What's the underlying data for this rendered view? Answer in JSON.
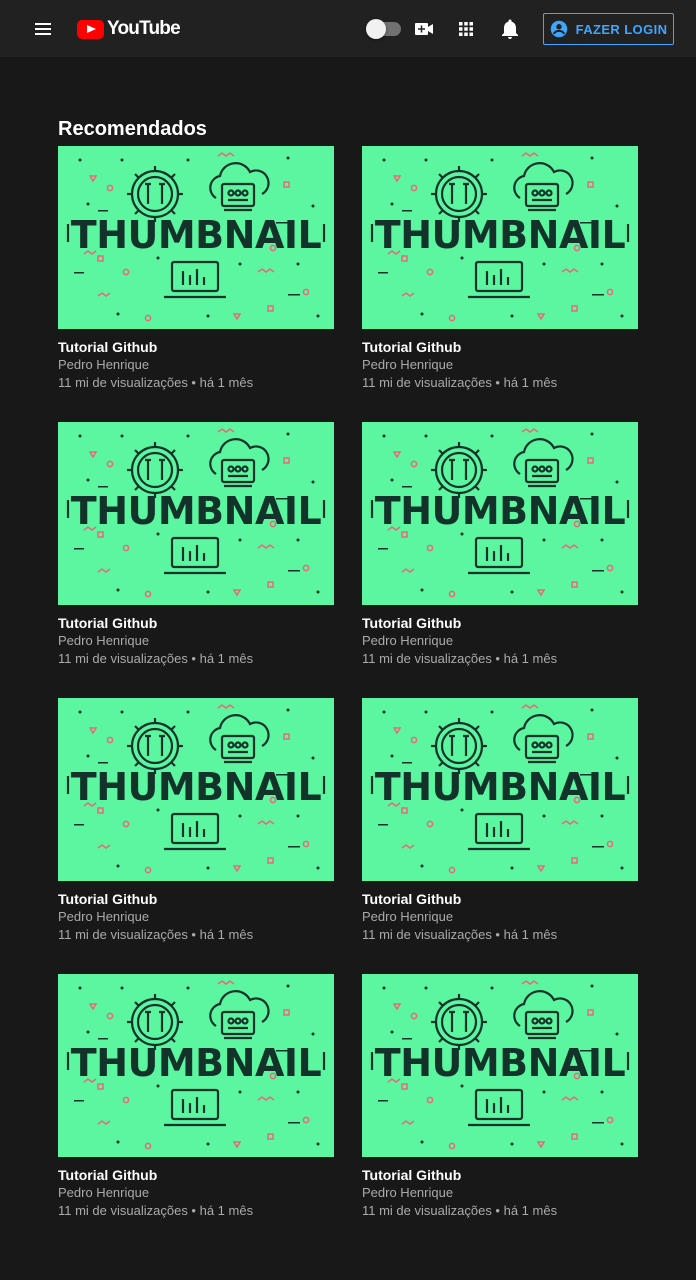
{
  "header": {
    "logo_text": "YouTube",
    "login_label": "FAZER LOGIN",
    "icons": [
      "menu-icon",
      "youtube-logo",
      "theme-toggle",
      "add-video-icon",
      "apps-grid-icon",
      "bell-icon",
      "account-circle-icon"
    ],
    "accent_color": "#3ea6ff",
    "brand_color": "#ff0000"
  },
  "section": {
    "title": "Recomendados"
  },
  "videos": [
    {
      "thumb_text": "THUMBNAIL",
      "title": "Tutorial Github",
      "channel": "Pedro Henrique",
      "meta": "11 mi de visualizações • há 1 mês"
    },
    {
      "thumb_text": "THUMBNAIL",
      "title": "Tutorial Github",
      "channel": "Pedro Henrique",
      "meta": "11 mi de visualizações • há 1 mês"
    },
    {
      "thumb_text": "THUMBNAIL",
      "title": "Tutorial Github",
      "channel": "Pedro Henrique",
      "meta": "11 mi de visualizações • há 1 mês"
    },
    {
      "thumb_text": "THUMBNAIL",
      "title": "Tutorial Github",
      "channel": "Pedro Henrique",
      "meta": "11 mi de visualizações • há 1 mês"
    },
    {
      "thumb_text": "THUMBNAIL",
      "title": "Tutorial Github",
      "channel": "Pedro Henrique",
      "meta": "11 mi de visualizações • há 1 mês"
    },
    {
      "thumb_text": "THUMBNAIL",
      "title": "Tutorial Github",
      "channel": "Pedro Henrique",
      "meta": "11 mi de visualizações • há 1 mês"
    },
    {
      "thumb_text": "THUMBNAIL",
      "title": "Tutorial Github",
      "channel": "Pedro Henrique",
      "meta": "11 mi de visualizações • há 1 mês"
    },
    {
      "thumb_text": "THUMBNAIL",
      "title": "Tutorial Github",
      "channel": "Pedro Henrique",
      "meta": "11 mi de visualizações • há 1 mês"
    }
  ]
}
